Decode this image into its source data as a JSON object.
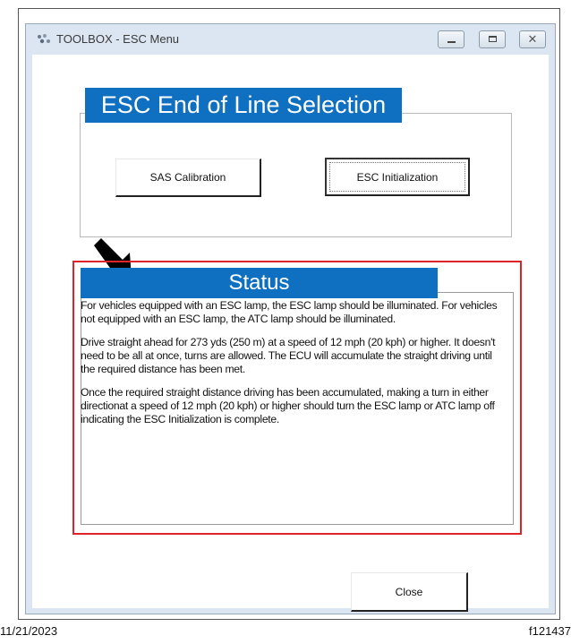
{
  "window": {
    "title": "TOOLBOX - ESC Menu",
    "icon": "toolbox-app-icon",
    "controls": {
      "minimize": "minimize-icon",
      "maximize": "maximize-icon",
      "close": "✕"
    }
  },
  "eol_section": {
    "header": "ESC End of Line Selection",
    "buttons": {
      "sas": "SAS Calibration",
      "esc_init": "ESC Initialization"
    }
  },
  "status": {
    "header": "Status",
    "paragraphs": [
      "For vehicles equipped with an ESC lamp, the ESC lamp should be illuminated. For vehicles not equipped with an ESC lamp, the ATC lamp should be illuminated.",
      "Drive straight ahead for 273 yds (250 m) at a speed of 12 mph (20 kph) or higher.  It doesn't need to be all at once, turns are allowed.  The ECU will accumulate the straight driving until the required distance has been met.",
      "Once the required straight distance driving has been accumulated, making a turn in either directionat a speed of 12 mph (20 kph) or higher should turn the ESC lamp or ATC lamp off indicating the ESC Initialization is complete."
    ]
  },
  "actions": {
    "close": "Close"
  },
  "footer": {
    "date": "11/21/2023",
    "figure_id": "f121437"
  },
  "colors": {
    "header_blue": "#0f6fc0",
    "highlight_red": "#e0222a",
    "window_bg": "#dce6f2"
  }
}
